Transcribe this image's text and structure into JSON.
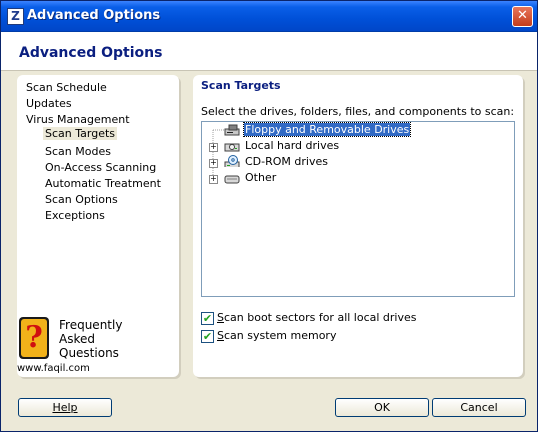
{
  "window": {
    "title": "Advanced Options",
    "app_icon": "Z"
  },
  "header": {
    "title": "Advanced Options"
  },
  "nav": {
    "items": [
      {
        "label": "Scan Schedule"
      },
      {
        "label": "Updates"
      },
      {
        "label": "Virus Management"
      },
      {
        "label": "Scan Targets"
      },
      {
        "label": "Scan Modes"
      },
      {
        "label": "On-Access Scanning"
      },
      {
        "label": "Automatic Treatment"
      },
      {
        "label": "Scan Options"
      },
      {
        "label": "Exceptions"
      }
    ],
    "selected": "Scan Targets"
  },
  "faq": {
    "glyph": "?",
    "line1": "Frequently",
    "line2": "Asked",
    "line3": "Questions",
    "url": "www.faqil.com"
  },
  "content": {
    "title": "Scan Targets",
    "instructions": "Select the drives, folders, files, and components to scan:",
    "tree": [
      {
        "label": "Floppy and Removable Drives",
        "icon": "floppy-drive-icon",
        "expander": "",
        "selected": true
      },
      {
        "label": "Local hard drives",
        "icon": "hard-drive-icon",
        "expander": "+",
        "selected": false
      },
      {
        "label": "CD-ROM drives",
        "icon": "cdrom-drive-icon",
        "expander": "+",
        "selected": false
      },
      {
        "label": "Other",
        "icon": "other-drive-icon",
        "expander": "+",
        "selected": false
      }
    ],
    "checkboxes": [
      {
        "label_rest": "can boot sectors for all local drives",
        "underline": "S",
        "checked": true
      },
      {
        "label_rest": "can system memory",
        "underline": "S",
        "checked": true
      }
    ],
    "check_mark": "✔"
  },
  "buttons": {
    "help": "Help",
    "ok": "OK",
    "cancel": "Cancel"
  },
  "colors": {
    "title_bar": "#0050d8",
    "header_text": "#0b1f80",
    "selection": "#316ac5"
  }
}
